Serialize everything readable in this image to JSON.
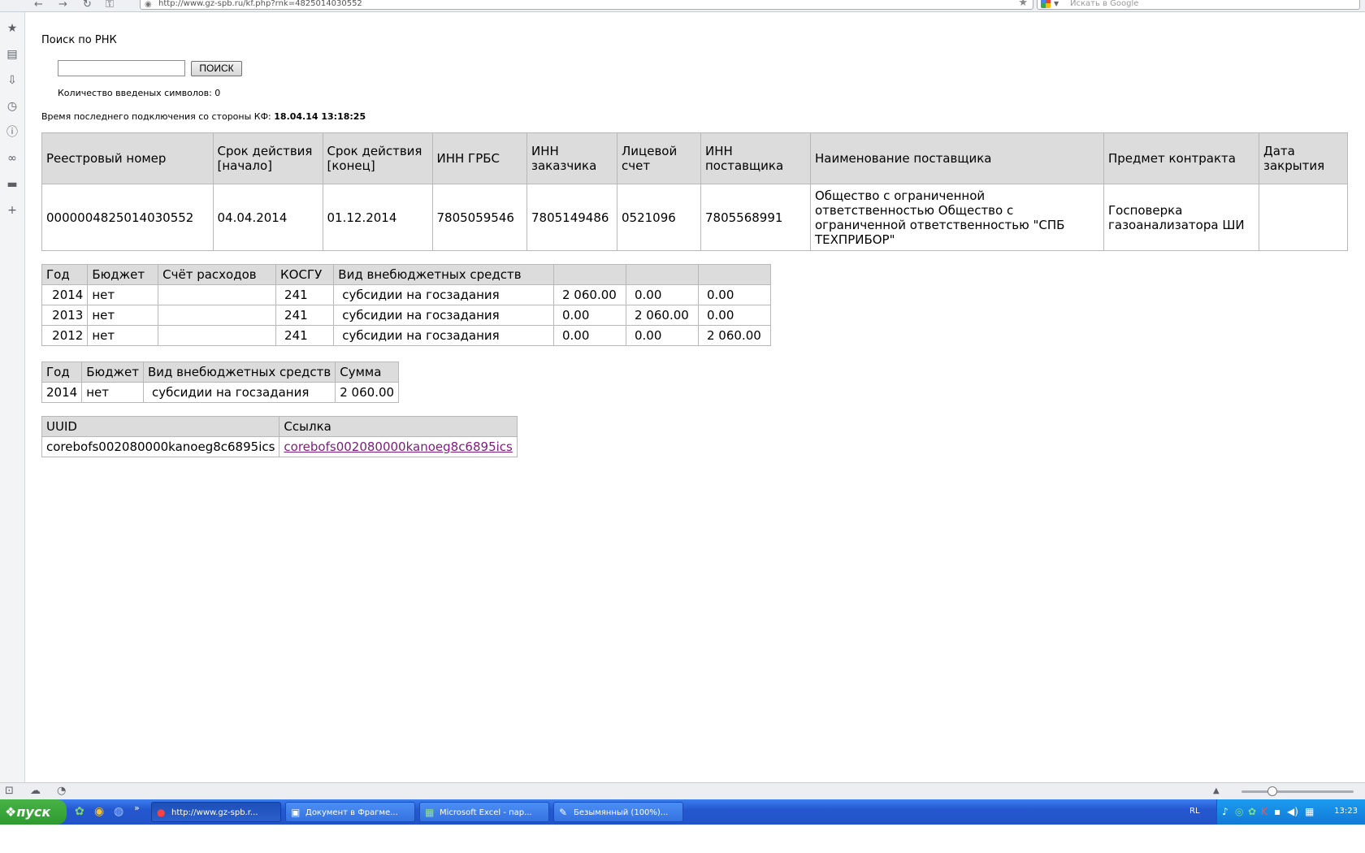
{
  "browser": {
    "url": "http://www.gz-spb.ru/kf.php?rnk=4825014030552",
    "search_placeholder": "Искать в Google"
  },
  "page": {
    "title": "Поиск по РНК",
    "search_value": "",
    "search_button": "ПОИСК",
    "char_count": "Количество введеных символов: 0",
    "last_conn_label": "Время последнего подключения со стороны КФ:",
    "last_conn_value": "18.04.14 13:18:25"
  },
  "contract_table": {
    "headers": [
      "Реестровый номер",
      "Срок действия [начало]",
      "Срок действия [конец]",
      "ИНН ГРБС",
      "ИНН заказчика",
      "Лицевой счет",
      "ИНН поставщика",
      "Наименование поставщика",
      "Предмет контракта",
      "Дата закрытия"
    ],
    "row": [
      "0000004825014030552",
      "04.04.2014",
      "01.12.2014",
      "7805059546",
      "7805149486",
      "0521096",
      "7805568991",
      "Общество с ограниченной ответственностью Общество с ограниченной ответственностью \"СПБ ТЕХПРИБОР\"",
      "Госповерка газоанализатора ШИ",
      ""
    ]
  },
  "budget_table": {
    "headers": [
      "Год",
      "Бюджет",
      "Счёт расходов",
      "КОСГУ",
      "Вид внебюджетных средств",
      "",
      "",
      ""
    ],
    "rows": [
      [
        "2014",
        "нет",
        "",
        "241",
        "субсидии на госзадания",
        "2 060.00",
        "0.00",
        "0.00"
      ],
      [
        "2013",
        "нет",
        "",
        "241",
        "субсидии на госзадания",
        "0.00",
        "2 060.00",
        "0.00"
      ],
      [
        "2012",
        "нет",
        "",
        "241",
        "субсидии на госзадания",
        "0.00",
        "0.00",
        "2 060.00"
      ]
    ]
  },
  "sum_table": {
    "headers": [
      "Год",
      "Бюджет",
      "Вид внебюджетных средств",
      "Сумма"
    ],
    "rows": [
      [
        "2014",
        "нет",
        "субсидии на госзадания",
        "2 060.00"
      ]
    ]
  },
  "uuid_table": {
    "headers": [
      "UUID",
      "Ссылка"
    ],
    "uuid": "corebofs002080000kanoeg8c6895ics",
    "link": "corebofs002080000kanoeg8c6895ics"
  },
  "taskbar": {
    "start": "пуск",
    "tasks": [
      "http://www.gz-spb.r...",
      "Документ в Фрагме...",
      "Microsoft Excel - пар...",
      "Безымянный (100%)..."
    ],
    "lang": "RL",
    "clock": "13:23"
  }
}
